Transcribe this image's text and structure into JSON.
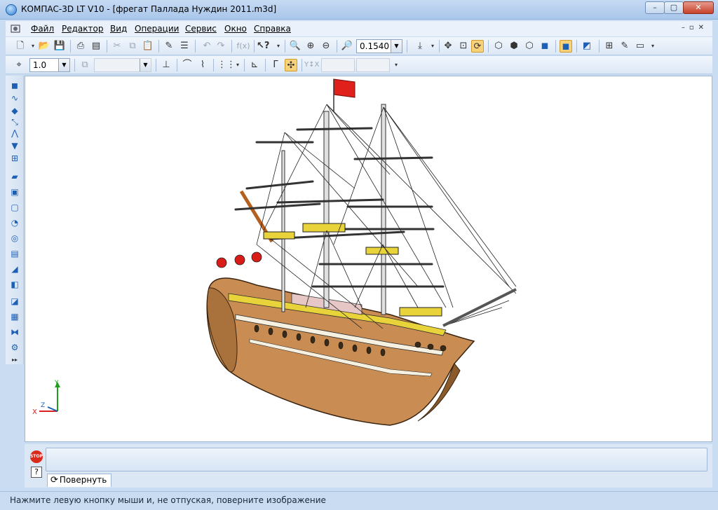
{
  "window": {
    "title": "КОМПАС-3D LT V10 - [фрегат Паллада Нуждин 2011.m3d]"
  },
  "menu": {
    "items": [
      {
        "label": "Файл"
      },
      {
        "label": "Редактор"
      },
      {
        "label": "Вид"
      },
      {
        "label": "Операции"
      },
      {
        "label": "Сервис"
      },
      {
        "label": "Окно"
      },
      {
        "label": "Справка"
      }
    ]
  },
  "toolbar": {
    "zoom_value": "0.1540",
    "step_value": "1.0"
  },
  "axes": {
    "x": "X",
    "y": "Y",
    "z": "Z"
  },
  "command_panel": {
    "tab_label": "Повернуть",
    "stop_label": "STOP"
  },
  "status": {
    "text": "Нажмите левую кнопку мыши и, не отпуская, поверните изображение"
  },
  "colors": {
    "hull": "#c98c52",
    "flag": "#e0201a",
    "deck_stripe": "#e8d43a",
    "window_bg": "#c9dcf1",
    "accent": "#1d5fb4"
  },
  "icons": [
    "app-logo-icon",
    "new-document-icon",
    "open-icon",
    "save-icon",
    "print-preview-icon",
    "cut-icon",
    "copy-icon",
    "paste-icon",
    "undo-icon",
    "redo-icon",
    "help-pointer-icon",
    "zoom-icon",
    "zoom-in-icon",
    "zoom-out-icon",
    "pan-icon",
    "rotate-icon",
    "shaded-view-icon",
    "stop-icon",
    "help-icon"
  ]
}
